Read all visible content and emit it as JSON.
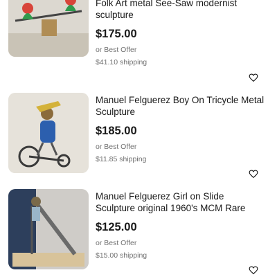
{
  "listings": [
    {
      "title": "Folk Art metal See-Saw modernist sculpture",
      "price": "$175.00",
      "offer": "or Best Offer",
      "shipping": "$41.10 shipping",
      "image_icon": "see-saw-sculpture-photo"
    },
    {
      "title": "Manuel Felguerez Boy On Tricycle Metal Sculpture",
      "price": "$185.00",
      "offer": "or Best Offer",
      "shipping": "$11.85 shipping",
      "image_icon": "tricycle-sculpture-photo"
    },
    {
      "title": "Manuel Felguerez Girl on Slide Sculpture original 1960's MCM Rare",
      "price": "$125.00",
      "offer": "or Best Offer",
      "shipping": "$15.00 shipping",
      "image_icon": "slide-sculpture-photo"
    }
  ],
  "colors": {
    "text": "#191919",
    "muted": "#707070"
  }
}
